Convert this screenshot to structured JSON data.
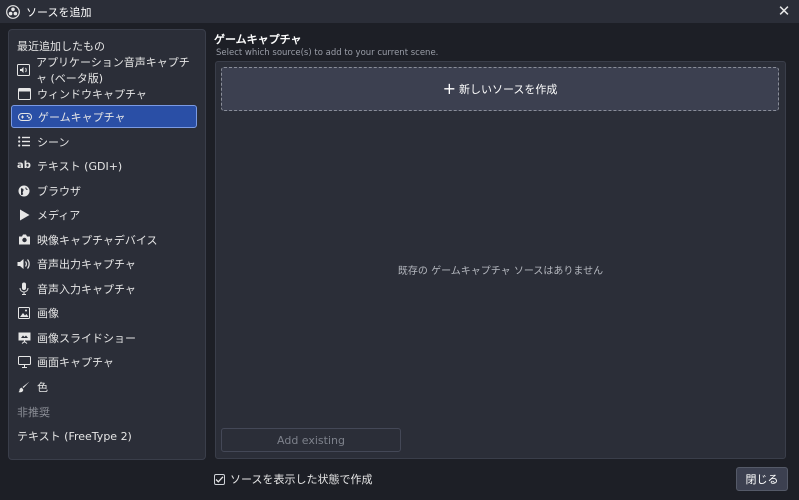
{
  "window": {
    "title": "ソースを追加",
    "app_icon": "obs-logo-icon",
    "close_icon": "close-icon"
  },
  "sidebar": {
    "recent_header": "最近追加したもの",
    "items": [
      {
        "label": "アプリケーション音声キャプチャ (ベータ版)",
        "icon": "app-audio-icon"
      },
      {
        "label": "ウィンドウキャプチャ",
        "icon": "window-icon"
      },
      {
        "label": "ゲームキャプチャ",
        "icon": "gamepad-icon",
        "selected": true
      },
      {
        "label": "シーン",
        "icon": "list-icon"
      },
      {
        "label": "テキスト (GDI+)",
        "icon": "text-ab-icon"
      },
      {
        "label": "ブラウザ",
        "icon": "globe-icon"
      },
      {
        "label": "メディア",
        "icon": "play-icon"
      },
      {
        "label": "映像キャプチャデバイス",
        "icon": "camera-icon"
      },
      {
        "label": "音声出力キャプチャ",
        "icon": "speaker-icon"
      },
      {
        "label": "音声入力キャプチャ",
        "icon": "microphone-icon"
      },
      {
        "label": "画像",
        "icon": "image-icon"
      },
      {
        "label": "画像スライドショー",
        "icon": "slideshow-icon"
      },
      {
        "label": "画面キャプチャ",
        "icon": "monitor-icon"
      },
      {
        "label": "色",
        "icon": "paintbrush-icon"
      }
    ],
    "deprecated_header": "非推奨",
    "deprecated_items": [
      {
        "label": "テキスト (FreeType 2)"
      }
    ]
  },
  "main": {
    "title": "ゲームキャプチャ",
    "subtitle": "Select which source(s) to add to your current scene.",
    "new_source_label": "新しいソースを作成",
    "empty_message": "既存の ゲームキャプチャ ソースはありません",
    "add_existing_label": "Add existing"
  },
  "footer": {
    "visible_checkbox_label": "ソースを表示した状態で作成",
    "visible_checked": true,
    "close_label": "閉じる"
  },
  "colors": {
    "accent": "#2a4fa6",
    "background": "#1d1f26",
    "panel": "#2b2e38"
  }
}
